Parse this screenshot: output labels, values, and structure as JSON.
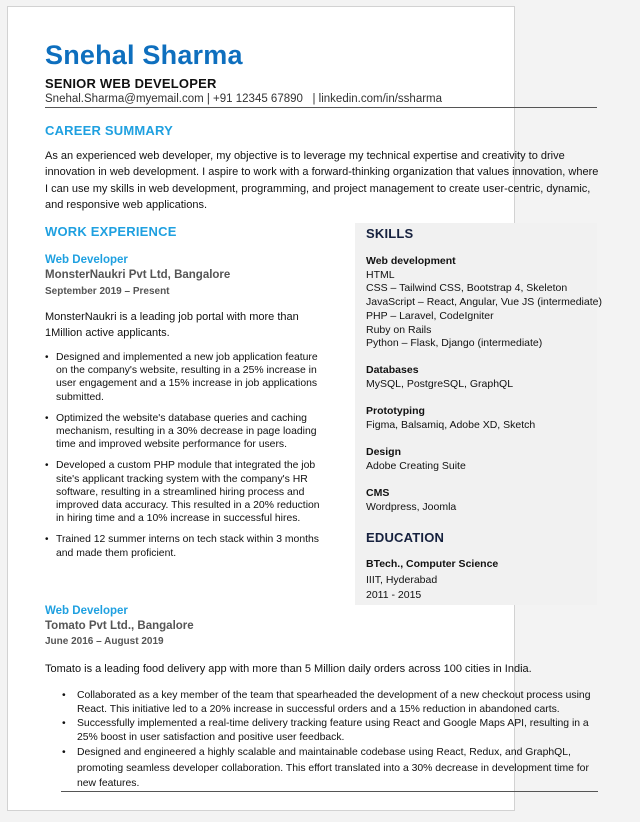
{
  "header": {
    "name": "Snehal Sharma",
    "title": "SENIOR WEB DEVELOPER",
    "contact": "Snehal.Sharma@myemail.com | +91 12345 67890   | linkedin.com/in/ssharma",
    "accent_color": "#0e6fbe",
    "section_color": "#1fa0e0"
  },
  "summary": {
    "heading": "CAREER SUMMARY",
    "text": "As an experienced web developer, my objective is to leverage my technical expertise and creativity to drive innovation in web development. I aspire to work with a forward-thinking organization that values innovation, where I can use my skills in web development, programming, and project management to create user-centric, dynamic, and responsive web applications."
  },
  "experience": {
    "heading": "WORK EXPERIENCE",
    "jobs": [
      {
        "title": "Web Developer",
        "company": "MonsterNaukri Pvt Ltd, Bangalore",
        "dates": "September 2019 – Present",
        "description": "MonsterNaukri is a leading job portal with more than 1Million active applicants.",
        "bullets": [
          "Designed and implemented a new job application feature on the company's website, resulting in a 25% increase in user engagement and a 15% increase in job applications submitted.",
          "Optimized the website's database queries and caching mechanism, resulting in a 30% decrease in page loading time and improved website performance for users.",
          "Developed a custom PHP module that integrated the job site's applicant tracking system with the company's HR software, resulting in a streamlined hiring process and improved data accuracy. This resulted in a 20% reduction in hiring time and a 10% increase in successful hires.",
          "Trained 12 summer interns on tech stack within 3 months and made them proficient."
        ]
      },
      {
        "title": "Web Developer",
        "company": "Tomato Pvt Ltd., Bangalore",
        "dates": "June 2016 – August 2019",
        "description": "Tomato is a leading food delivery app with more than 5 Million daily orders across 100 cities in India.",
        "bullets": [
          "Collaborated as a key member of the team that spearheaded the development of a new checkout process using React. This initiative led to a 20% increase in successful orders and a 15% reduction in abandoned carts.",
          "Successfully implemented a real-time delivery tracking feature using React and Google Maps API, resulting in a 25% boost in user satisfaction and positive user feedback.",
          "Designed and engineered a highly scalable and maintainable codebase using React, Redux, and GraphQL, promoting seamless developer collaboration. This effort translated into a 30% decrease in development time for new features."
        ]
      }
    ]
  },
  "skills": {
    "heading": "SKILLS",
    "groups": [
      {
        "category": "Web development",
        "items": [
          "HTML",
          "CSS – Tailwind CSS, Bootstrap 4, Skeleton",
          "JavaScript – React, Angular, Vue JS (intermediate)",
          "PHP – Laravel, CodeIgniter",
          "Ruby on Rails",
          "Python – Flask, Django (intermediate)"
        ]
      },
      {
        "category": "Databases",
        "items": [
          "MySQL, PostgreSQL, GraphQL"
        ]
      },
      {
        "category": "Prototyping",
        "items": [
          "Figma, Balsamiq, Adobe XD, Sketch"
        ]
      },
      {
        "category": "Design",
        "items": [
          "Adobe Creating Suite"
        ]
      },
      {
        "category": "CMS",
        "items": [
          "Wordpress, Joomla"
        ]
      }
    ]
  },
  "education": {
    "heading": "EDUCATION",
    "degree": "BTech., Computer Science",
    "institution": "IIIT, Hyderabad",
    "years": "2011 - 2015"
  },
  "bullet_glyph": "•"
}
